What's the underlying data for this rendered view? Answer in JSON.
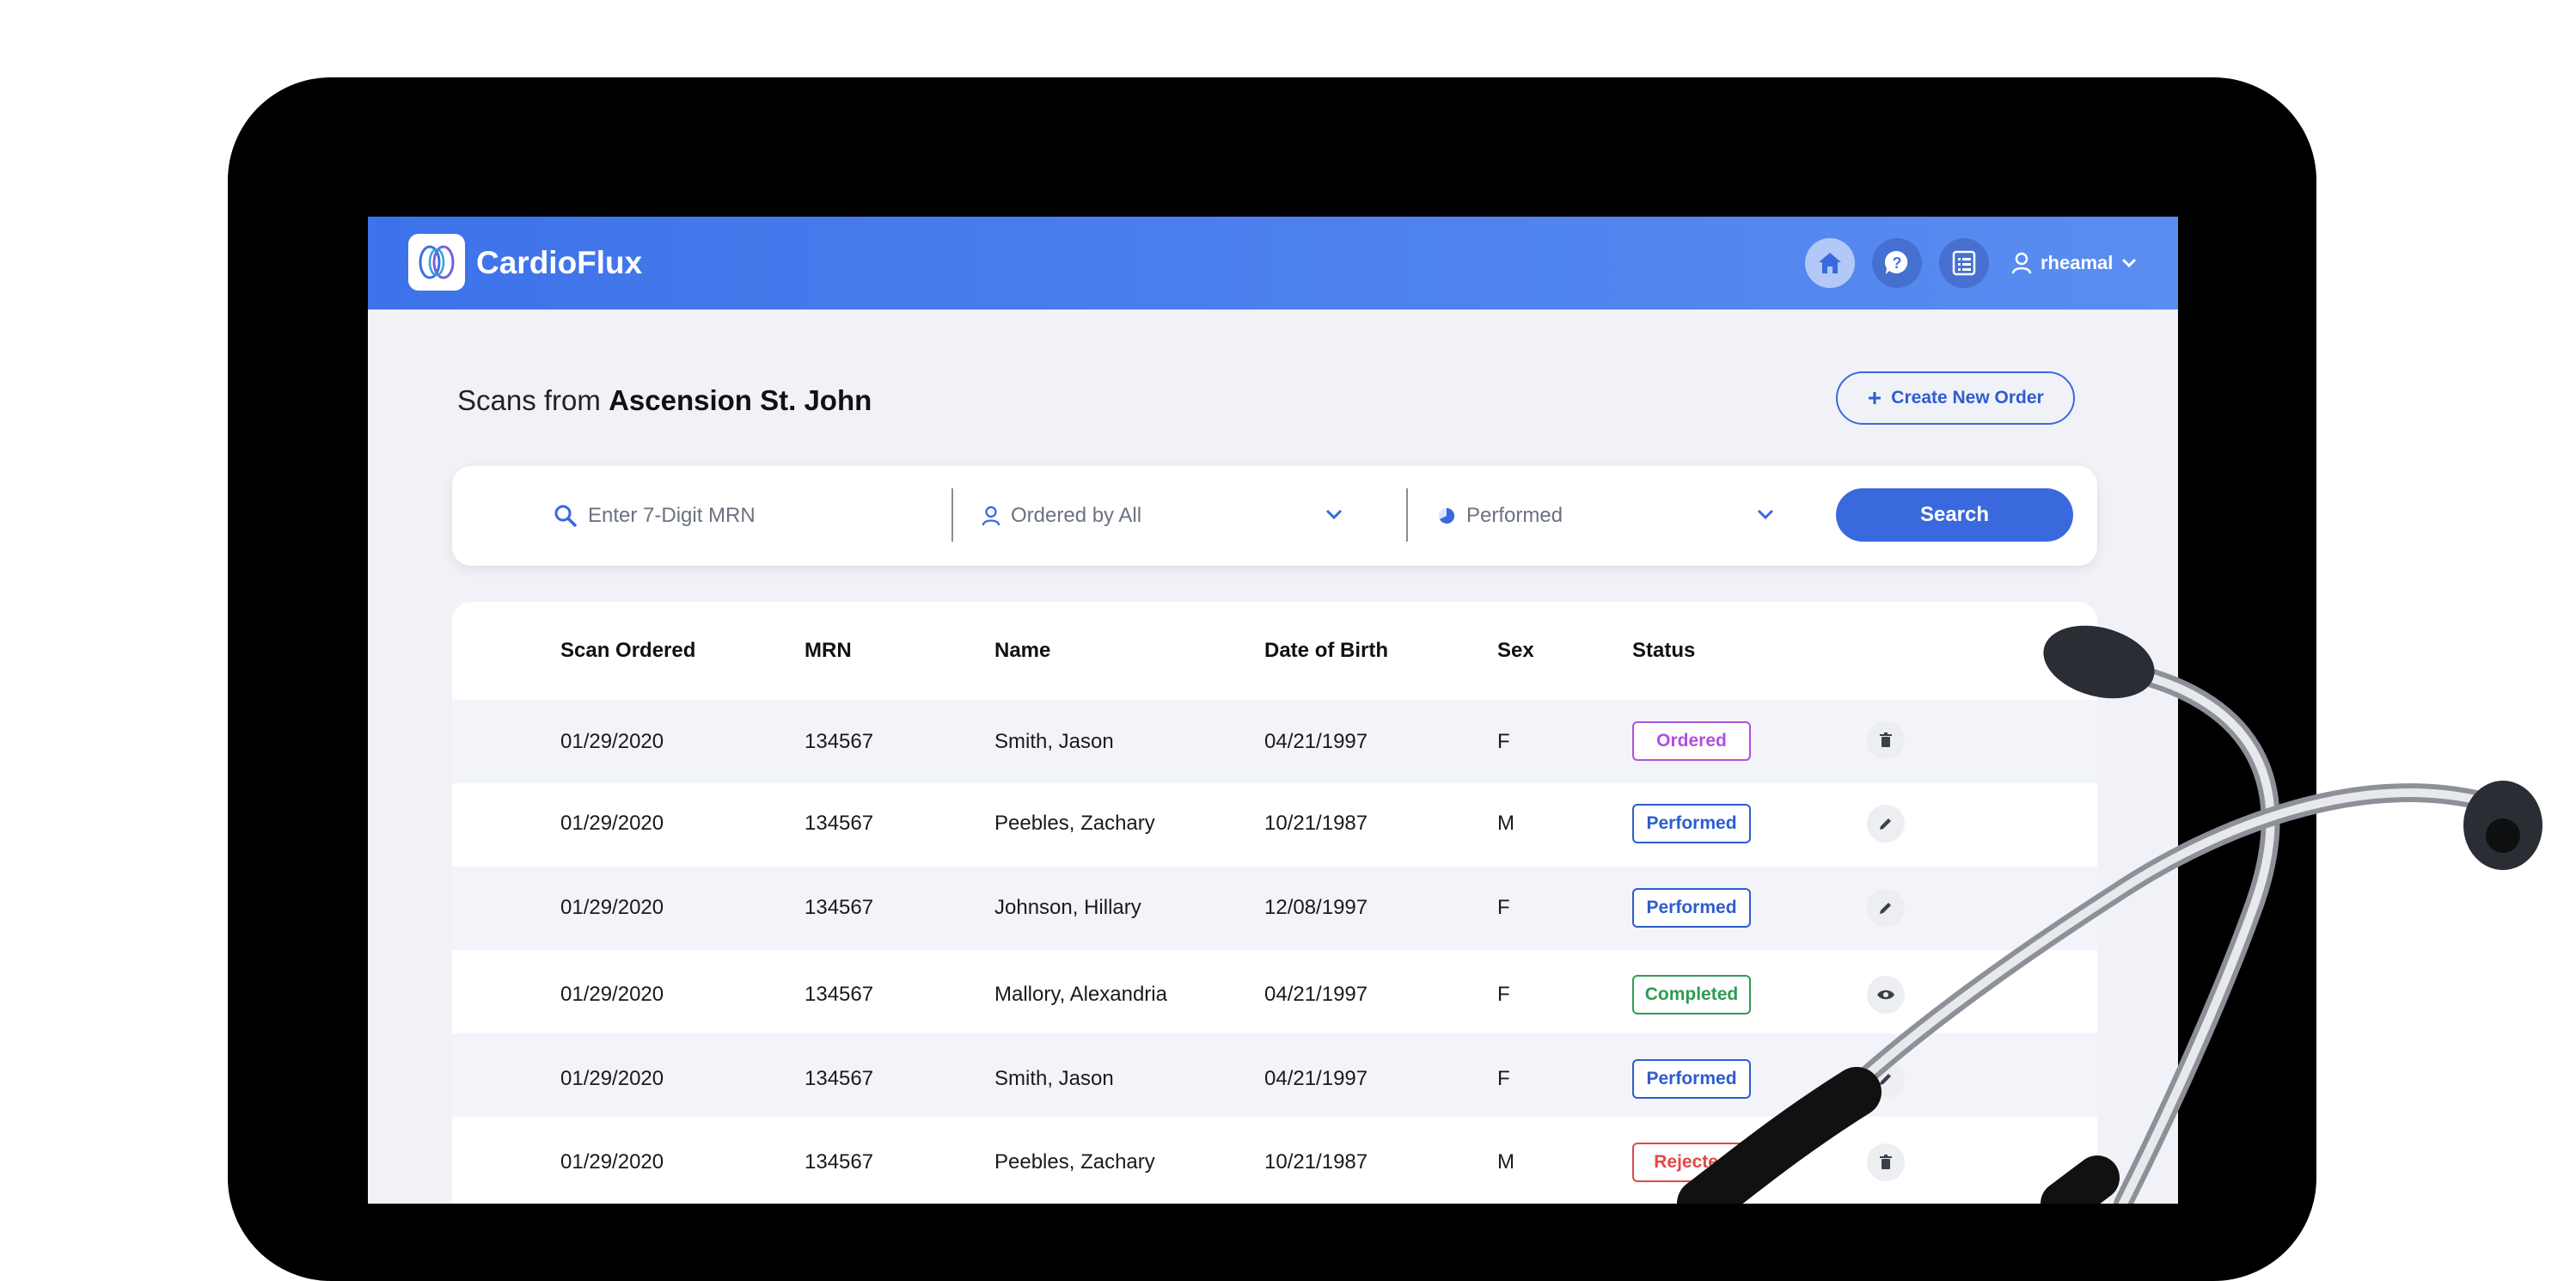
{
  "app": {
    "brand": "CardioFlux"
  },
  "nav": {
    "home_icon": "home-icon",
    "help_icon": "help-icon",
    "list_icon": "list-icon",
    "username": "rheamal"
  },
  "page": {
    "title_prefix": "Scans from",
    "title_site": "Ascension St. John",
    "create_label": "Create New Order"
  },
  "search": {
    "mrn_placeholder": "Enter 7-Digit MRN",
    "ordered_by": "Ordered by All",
    "status": "Performed",
    "button_label": "Search"
  },
  "table": {
    "headers": [
      "Scan Ordered",
      "MRN",
      "Name",
      "Date of Birth",
      "Sex",
      "Status"
    ],
    "rows": [
      {
        "ordered": "01/29/2020",
        "mrn": "134567",
        "name": "Smith, Jason",
        "dob": "04/21/1997",
        "sex": "F",
        "status": "Ordered",
        "action": "trash-icon"
      },
      {
        "ordered": "01/29/2020",
        "mrn": "134567",
        "name": "Peebles, Zachary",
        "dob": "10/21/1987",
        "sex": "M",
        "status": "Performed",
        "action": "pencil-icon"
      },
      {
        "ordered": "01/29/2020",
        "mrn": "134567",
        "name": "Johnson, Hillary",
        "dob": "12/08/1997",
        "sex": "F",
        "status": "Performed",
        "action": "pencil-icon"
      },
      {
        "ordered": "01/29/2020",
        "mrn": "134567",
        "name": "Mallory, Alexandria",
        "dob": "04/21/1997",
        "sex": "F",
        "status": "Completed",
        "action": "eye-icon"
      },
      {
        "ordered": "01/29/2020",
        "mrn": "134567",
        "name": "Smith, Jason",
        "dob": "04/21/1997",
        "sex": "F",
        "status": "Performed",
        "action": "pencil-icon"
      },
      {
        "ordered": "01/29/2020",
        "mrn": "134567",
        "name": "Peebles, Zachary",
        "dob": "10/21/1987",
        "sex": "M",
        "status": "Rejected",
        "action": "trash-icon"
      }
    ]
  },
  "colors": {
    "primary": "#3a69dd",
    "ordered": "#b050e0",
    "performed": "#2e5ccf",
    "completed": "#2f9a52",
    "rejected": "#e04848"
  }
}
